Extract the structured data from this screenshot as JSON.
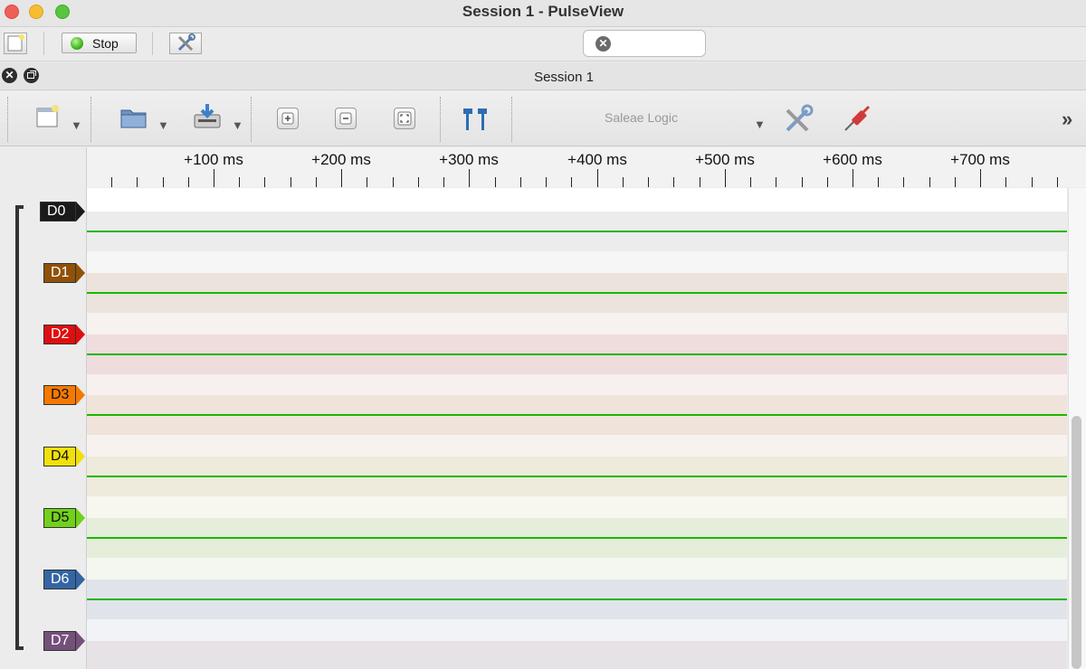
{
  "window": {
    "title": "Session 1 - PulseView"
  },
  "toolbar": {
    "stop_label": "Stop",
    "search_value": ""
  },
  "session": {
    "title": "Session 1",
    "device": "Saleae Logic"
  },
  "ruler": {
    "labels": [
      "+100 ms",
      "+200 ms",
      "+300 ms",
      "+400 ms",
      "+500 ms",
      "+600 ms",
      "+700 ms"
    ]
  },
  "channels": [
    {
      "name": "D0",
      "color": "#1a1a1a",
      "text_color": "#ffffff",
      "band": "#ececec"
    },
    {
      "name": "D1",
      "color": "#8f5208",
      "text_color": "#ffffff",
      "band": "#ebe3dc"
    },
    {
      "name": "D2",
      "color": "#e00f0f",
      "text_color": "#ffffff",
      "band": "#efdcdc"
    },
    {
      "name": "D3",
      "color": "#f57900",
      "text_color": "#111111",
      "band": "#efe3da"
    },
    {
      "name": "D4",
      "color": "#f0e00b",
      "text_color": "#111111",
      "band": "#eeeadc"
    },
    {
      "name": "D5",
      "color": "#72d11a",
      "text_color": "#111111",
      "band": "#e5eedb"
    },
    {
      "name": "D6",
      "color": "#3465a4",
      "text_color": "#ffffff",
      "band": "#e0e4ea"
    },
    {
      "name": "D7",
      "color": "#75507b",
      "text_color": "#ffffff",
      "band": "#e6e2e6"
    }
  ]
}
